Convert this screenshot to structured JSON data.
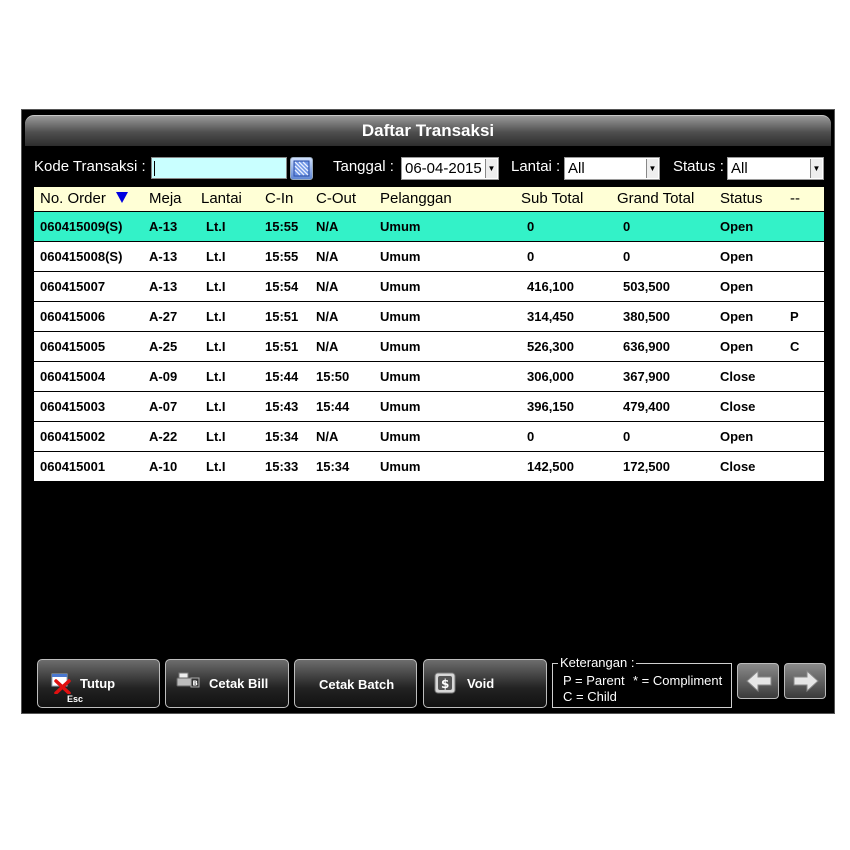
{
  "window": {
    "title": "Daftar Transaksi"
  },
  "filters": {
    "kode_label": "Kode Transaksi :",
    "kode_value": "",
    "tanggal_label": "Tanggal :",
    "tanggal_value": "06-04-2015",
    "lantai_label": "Lantai :",
    "lantai_value": "All",
    "status_label": "Status :",
    "status_value": "All"
  },
  "table": {
    "columns": [
      "No. Order",
      "Meja",
      "Lantai",
      "C-In",
      "C-Out",
      "Pelanggan",
      "Sub Total",
      "Grand Total",
      "Status",
      "--"
    ],
    "sort_indicator": "sort-down-icon",
    "selected_row": 0,
    "rows": [
      [
        "060415009(S)",
        "A-13",
        "Lt.I",
        "15:55",
        "N/A",
        "Umum",
        "0",
        "0",
        "Open",
        ""
      ],
      [
        "060415008(S)",
        "A-13",
        "Lt.I",
        "15:55",
        "N/A",
        "Umum",
        "0",
        "0",
        "Open",
        ""
      ],
      [
        "060415007",
        "A-13",
        "Lt.I",
        "15:54",
        "N/A",
        "Umum",
        "416,100",
        "503,500",
        "Open",
        ""
      ],
      [
        "060415006",
        "A-27",
        "Lt.I",
        "15:51",
        "N/A",
        "Umum",
        "314,450",
        "380,500",
        "Open",
        "P"
      ],
      [
        "060415005",
        "A-25",
        "Lt.I",
        "15:51",
        "N/A",
        "Umum",
        "526,300",
        "636,900",
        "Open",
        "C"
      ],
      [
        "060415004",
        "A-09",
        "Lt.I",
        "15:44",
        "15:50",
        "Umum",
        "306,000",
        "367,900",
        "Close",
        ""
      ],
      [
        "060415003",
        "A-07",
        "Lt.I",
        "15:43",
        "15:44",
        "Umum",
        "396,150",
        "479,400",
        "Close",
        ""
      ],
      [
        "060415002",
        "A-22",
        "Lt.I",
        "15:34",
        "N/A",
        "Umum",
        "0",
        "0",
        "Open",
        ""
      ],
      [
        "060415001",
        "A-10",
        "Lt.I",
        "15:33",
        "15:34",
        "Umum",
        "142,500",
        "172,500",
        "Close",
        ""
      ]
    ]
  },
  "buttons": {
    "tutup": "Tutup",
    "tutup_key": "Esc",
    "cetak_bill": "Cetak Bill",
    "cetak_batch": "Cetak Batch",
    "void": "Void"
  },
  "legend": {
    "title": "Keterangan :",
    "parent": "P = Parent",
    "compliment": "* = Compliment",
    "child": "C = Child"
  },
  "colors": {
    "selected_row": "#33f2c8",
    "header_bg": "#ffffd6",
    "input_bg": "#c9ffff"
  }
}
